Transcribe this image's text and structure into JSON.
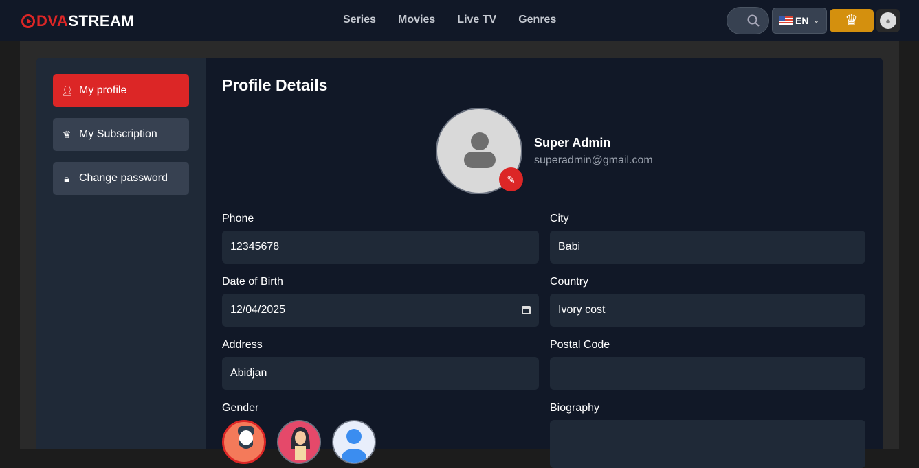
{
  "header": {
    "logo_left": "DVA",
    "logo_right": "STREAM",
    "nav": [
      "Series",
      "Movies",
      "Live TV",
      "Genres"
    ],
    "lang": "EN"
  },
  "sidebar": {
    "items": [
      {
        "label": "My profile",
        "icon": "user-icon"
      },
      {
        "label": "My Subscription",
        "icon": "crown-icon"
      },
      {
        "label": "Change password",
        "icon": "lock-icon"
      }
    ]
  },
  "profile": {
    "title": "Profile Details",
    "name": "Super Admin",
    "email": "superadmin@gmail.com",
    "fields": {
      "phone": {
        "label": "Phone",
        "value": "12345678"
      },
      "city": {
        "label": "City",
        "value": "Babi"
      },
      "dob": {
        "label": "Date of Birth",
        "value": "12/04/2025"
      },
      "country": {
        "label": "Country",
        "value": "Ivory cost"
      },
      "address": {
        "label": "Address",
        "value": "Abidjan"
      },
      "postal": {
        "label": "Postal Code",
        "value": ""
      },
      "gender": {
        "label": "Gender"
      },
      "bio": {
        "label": "Biography",
        "value": ""
      }
    }
  },
  "colors": {
    "accent": "#dc2626",
    "gold": "#d4900e"
  }
}
